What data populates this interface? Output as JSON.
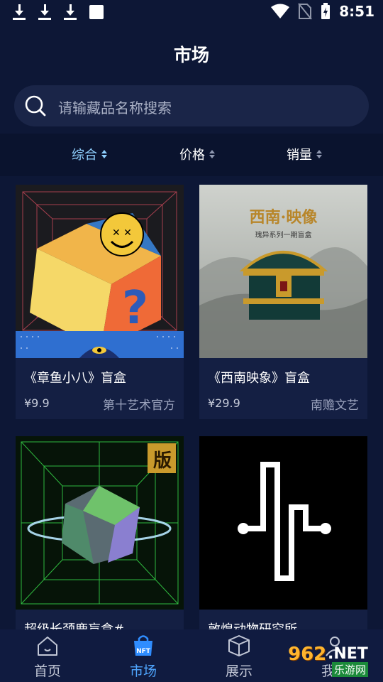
{
  "status_bar": {
    "time": "8:51"
  },
  "header": {
    "title": "市场"
  },
  "search": {
    "placeholder": "请输藏品名称搜索"
  },
  "sort": {
    "items": [
      {
        "label": "综合",
        "active": true
      },
      {
        "label": "价格",
        "active": false
      },
      {
        "label": "销量",
        "active": false
      }
    ]
  },
  "products": [
    {
      "title": "《章鱼小八》盲盒",
      "price": "¥9.9",
      "maker": "第十艺术官方",
      "image_text": ""
    },
    {
      "title": "《西南映象》盲盒",
      "price": "¥29.9",
      "maker": "南赡文艺",
      "image_title": "西南·映像",
      "image_subtitle": "瑰异系列一期盲盒"
    },
    {
      "title": "超级长颈鹿盲盒#",
      "price": "",
      "maker": "",
      "badge": "版"
    },
    {
      "title": "敦煌动物研究所",
      "price": "",
      "maker": ""
    }
  ],
  "bottom_nav": {
    "items": [
      {
        "label": "首页",
        "active": false
      },
      {
        "label": "市场",
        "active": true
      },
      {
        "label": "展示",
        "active": false
      },
      {
        "label": "我的",
        "active": false
      }
    ],
    "nft_icon_text": "NFT"
  },
  "watermark": {
    "number": "962",
    "suffix": ".NET",
    "cn": "乐游网"
  },
  "colors": {
    "background": "#0d1736",
    "accent": "#4fa6ff",
    "sort_active": "#8fd0ff"
  }
}
